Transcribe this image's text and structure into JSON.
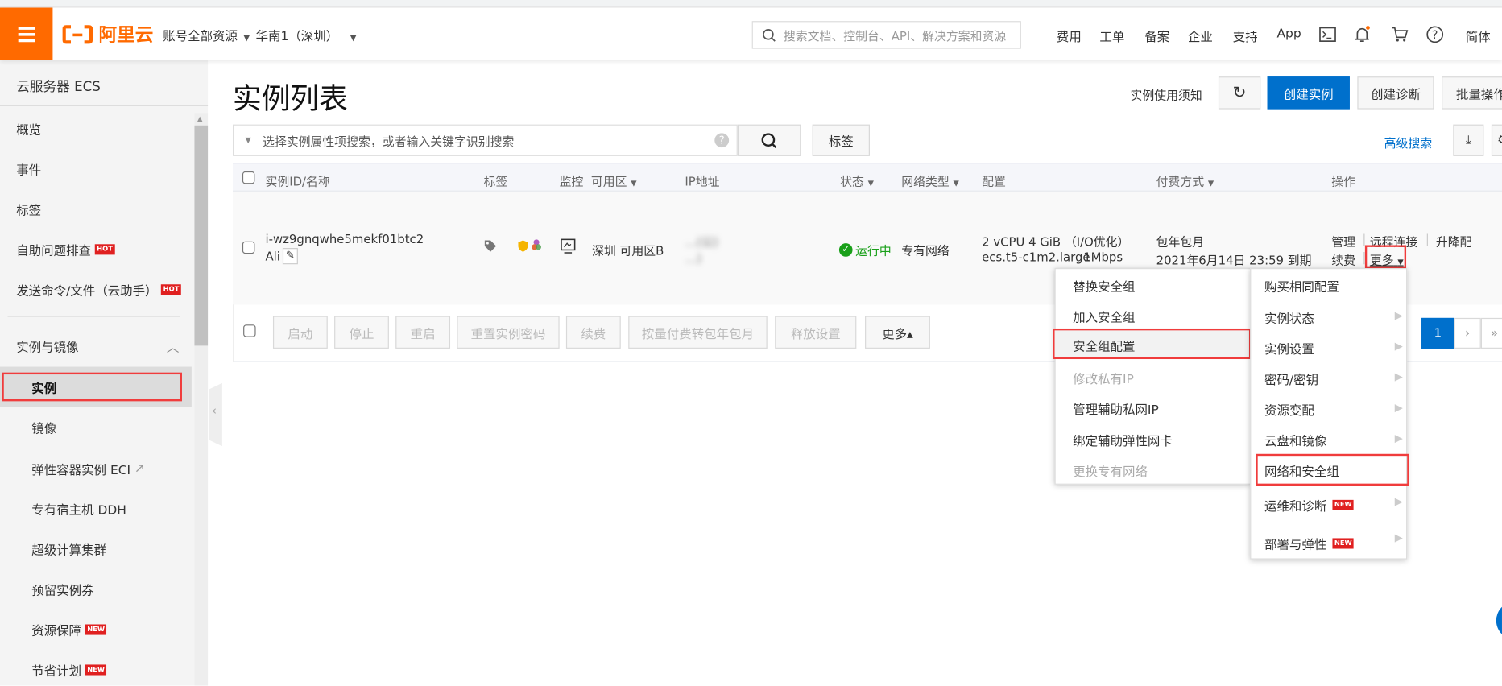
{
  "header": {
    "brand": "阿里云",
    "account_scope": "账号全部资源",
    "region": "华南1（深圳）",
    "search_placeholder": "搜索文档、控制台、API、解决方案和资源",
    "nav": [
      "费用",
      "工单",
      "备案",
      "企业",
      "支持",
      "App"
    ],
    "language": "简体",
    "accent": "#ff6a00"
  },
  "sidebar": {
    "title": "云服务器 ECS",
    "items": [
      {
        "label": "概览"
      },
      {
        "label": "事件"
      },
      {
        "label": "标签"
      },
      {
        "label": "自助问题排查",
        "badge": "HOT"
      },
      {
        "label": "发送命令/文件（云助手）",
        "badge": "HOT"
      }
    ],
    "group": "实例与镜像",
    "sub_items": [
      {
        "label": "实例",
        "selected": true
      },
      {
        "label": "镜像"
      },
      {
        "label": "弹性容器实例 ECI"
      },
      {
        "label": "专有宿主机 DDH"
      },
      {
        "label": "超级计算集群"
      },
      {
        "label": "预留实例券"
      },
      {
        "label": "资源保障",
        "badge": "NEW"
      },
      {
        "label": "节省计划",
        "badge": "NEW"
      }
    ]
  },
  "page": {
    "title": "实例列表",
    "notice": "实例使用须知",
    "create": "创建实例",
    "diagnose": "创建诊断",
    "batch": "批量操作",
    "search_placeholder": "选择实例属性项搜索，或者输入关键字识别搜索",
    "tag_button": "标签",
    "advanced_search": "高级搜索",
    "primary_color": "#0070cc"
  },
  "table": {
    "columns": [
      "实例ID/名称",
      "标签",
      "监控",
      "可用区",
      "IP地址",
      "状态",
      "网络类型",
      "配置",
      "付费方式",
      "操作"
    ],
    "row": {
      "id": "i-wz9gnqwhe5mekf01btc2",
      "name": "Ali",
      "zone": "深圳 可用区B",
      "ip_line1": "…(公)",
      "ip_line2": "…)",
      "status": "运行中",
      "network": "专有网络",
      "config_line1": "2 vCPU 4 GiB （I/O优化）",
      "instance_type": "ecs.t5-c1m2.large",
      "bandwidth": "1Mbps",
      "billing": "包年包月",
      "expiry": "2021年6月14日 23:59 到期",
      "actions": [
        "管理",
        "远程连接",
        "升降配",
        "续费",
        "更多"
      ]
    }
  },
  "toolbar": {
    "buttons": [
      "启动",
      "停止",
      "重启",
      "重置实例密码",
      "续费",
      "按量付费转包年包月",
      "释放设置"
    ],
    "more": "更多▴",
    "page": "1",
    "next": "›",
    "last": "»"
  },
  "submenu": {
    "items": [
      {
        "label": "替换安全组"
      },
      {
        "label": "加入安全组"
      },
      {
        "label": "安全组配置",
        "highlighted": true
      },
      {
        "label": "修改私有IP",
        "disabled": true
      },
      {
        "label": "管理辅助私网IP"
      },
      {
        "label": "绑定辅助弹性网卡"
      },
      {
        "label": "更换专有网络",
        "disabled": true
      }
    ]
  },
  "more_menu": {
    "items": [
      {
        "label": "购买相同配置"
      },
      {
        "label": "实例状态"
      },
      {
        "label": "实例设置"
      },
      {
        "label": "密码/密钥"
      },
      {
        "label": "资源变配"
      },
      {
        "label": "云盘和镜像"
      },
      {
        "label": "网络和安全组",
        "highlighted": true
      },
      {
        "label": "运维和诊断",
        "badge": "NEW"
      },
      {
        "label": "部署与弹性",
        "badge": "NEW"
      }
    ]
  }
}
